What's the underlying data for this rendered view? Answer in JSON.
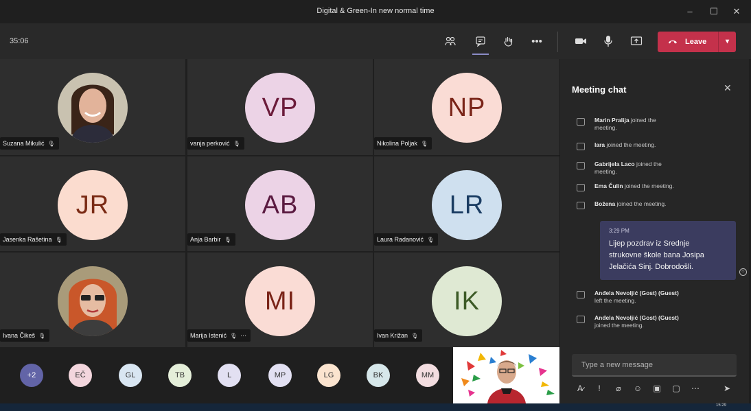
{
  "window": {
    "title": "Digital & Green-In new normal time",
    "controls": [
      "–",
      "☐",
      "✕"
    ]
  },
  "toolbar": {
    "timer": "35:06",
    "leave_label": "Leave"
  },
  "participants": [
    {
      "name": "Suzana Mikulić",
      "photo": true
    },
    {
      "name": "vanja perković",
      "initials": "VP",
      "bg": "#ecd3e6",
      "fg": "#6b1b3a"
    },
    {
      "name": "Nikolina Poljak",
      "initials": "NP",
      "bg": "#fadcd5",
      "fg": "#7a2418"
    },
    {
      "name": "Jasenka Rašetina",
      "initials": "JR",
      "bg": "#fbdccf",
      "fg": "#7a2a14"
    },
    {
      "name": "Anja Barbir",
      "initials": "AB",
      "bg": "#ecd3e6",
      "fg": "#5a1a40"
    },
    {
      "name": "Laura Radanović",
      "initials": "LR",
      "bg": "#cfe0ef",
      "fg": "#1a3c62"
    },
    {
      "name": "Ivana Čikeš",
      "photo": true
    },
    {
      "name": "Marija Istenić",
      "initials": "MI",
      "bg": "#fadcd5",
      "fg": "#7a2418",
      "more": true
    },
    {
      "name": "Ivan Križan",
      "initials": "IK",
      "bg": "#dfe9d3",
      "fg": "#3c5a26"
    }
  ],
  "strip": [
    {
      "initials": "+2",
      "bg": "#6264a7",
      "fg": "#ffffff"
    },
    {
      "initials": "EČ",
      "bg": "#f3d6dd",
      "fg": "#333"
    },
    {
      "initials": "GL",
      "bg": "#d9e6f2",
      "fg": "#333"
    },
    {
      "initials": "TB",
      "bg": "#e4eed9",
      "fg": "#333"
    },
    {
      "initials": "L",
      "bg": "#e2e0f2",
      "fg": "#333"
    },
    {
      "initials": "MP",
      "bg": "#e2e0f2",
      "fg": "#333"
    },
    {
      "initials": "LG",
      "bg": "#fbe4cf",
      "fg": "#333"
    },
    {
      "initials": "BK",
      "bg": "#d6e7ea",
      "fg": "#333"
    },
    {
      "initials": "MM",
      "bg": "#f3dde0",
      "fg": "#333"
    }
  ],
  "chat": {
    "title": "Meeting chat",
    "system_messages": [
      {
        "name": "Marin Pralija",
        "line1": "joined the",
        "line2": "meeting."
      },
      {
        "name": "Iara",
        "line1": "joined the meeting.",
        "line2": ""
      },
      {
        "name": "Gabrijela Laco",
        "line1": "joined the",
        "line2": "meeting."
      },
      {
        "name": "Ema Čulin",
        "line1": "joined the meeting.",
        "line2": ""
      },
      {
        "name": "Božena",
        "line1": "joined the meeting.",
        "line2": ""
      }
    ],
    "message": {
      "time": "3:29 PM",
      "text_lines": [
        "Lijep pozdrav iz Srednje",
        "strukovne škole bana Josipa",
        "Jelačića Sinj. Dobrodošli."
      ]
    },
    "after_messages": [
      {
        "name": "Anđela Nevoljić (Gost) (Guest)",
        "line1": "",
        "line2": "left the meeting."
      },
      {
        "name": "Anđela Nevoljić (Gost) (Guest)",
        "line1": "",
        "line2": "joined the meeting."
      }
    ],
    "compose_placeholder": "Type a new message"
  },
  "taskbar": {
    "clock": "15:29"
  }
}
